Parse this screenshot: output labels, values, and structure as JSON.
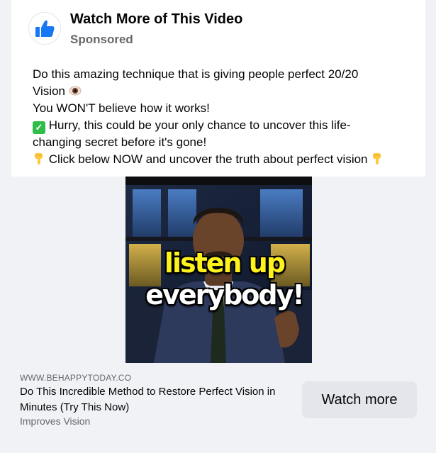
{
  "post": {
    "page_name": "Watch More of This Video",
    "sponsored_label": "Sponsored",
    "text_lines": [
      "Do this amazing technique that is giving people perfect 20/20",
      "Vision",
      "You WON'T believe how it works!",
      "Hurry, this could be your only chance to uncover this life-",
      "changing secret before it's gone!",
      "Click below NOW and uncover the truth about perfect vision"
    ]
  },
  "video": {
    "caption_line1": "listen up",
    "caption_line2": "everybody!"
  },
  "link_preview": {
    "domain": "WWW.BEHAPPYTODAY.CO",
    "headline": "Do This Incredible Method to Restore Perfect Vision in Minutes (Try This Now)",
    "description": "Improves Vision",
    "cta_label": "Watch more"
  },
  "icons": {
    "avatar": "thumbs-up-icon",
    "eye": "eye-icon",
    "check": "check-mark-icon",
    "hand": "pointing-down-hand-icon"
  },
  "colors": {
    "brand_blue": "#1877f2",
    "caption_yellow": "#fdf21c",
    "check_green": "#2fbd4a"
  }
}
